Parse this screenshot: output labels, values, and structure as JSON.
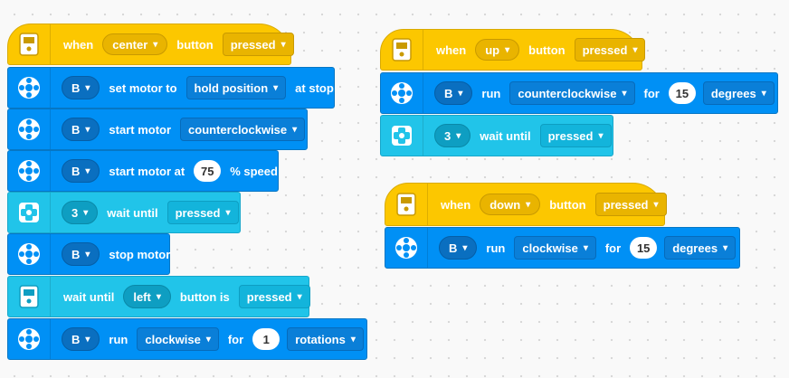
{
  "stack1": {
    "hat": {
      "when": "when",
      "button": "center",
      "mid": "button",
      "state": "pressed"
    },
    "b1": {
      "port": "B",
      "label": "set motor to",
      "mode": "hold position",
      "tail": "at stop"
    },
    "b2": {
      "port": "B",
      "label": "start motor",
      "dir": "counterclockwise"
    },
    "b3": {
      "port": "B",
      "label": "start motor at",
      "value": "75",
      "tail": "% speed"
    },
    "b4": {
      "port": "3",
      "label": "wait until",
      "state": "pressed"
    },
    "b5": {
      "port": "B",
      "label": "stop motor"
    },
    "b6": {
      "label": "wait until",
      "button": "left",
      "mid": "button is",
      "state": "pressed"
    },
    "b7": {
      "port": "B",
      "label": "run",
      "dir": "clockwise",
      "for": "for",
      "value": "1",
      "unit": "rotations"
    }
  },
  "stack2": {
    "hat": {
      "when": "when",
      "button": "up",
      "mid": "button",
      "state": "pressed"
    },
    "b1": {
      "port": "B",
      "label": "run",
      "dir": "counterclockwise",
      "for": "for",
      "value": "15",
      "unit": "degrees"
    },
    "b2": {
      "port": "3",
      "label": "wait until",
      "state": "pressed"
    }
  },
  "stack3": {
    "hat": {
      "when": "when",
      "button": "down",
      "mid": "button",
      "state": "pressed"
    },
    "b1": {
      "port": "B",
      "label": "run",
      "dir": "clockwise",
      "for": "for",
      "value": "15",
      "unit": "degrees"
    }
  },
  "caret": "▾",
  "icons": {
    "hub": "hub-icon",
    "motor": "motor-icon",
    "force": "force-sensor-icon"
  },
  "colors": {
    "motor": "#0090f5",
    "sensor": "#21c4e9",
    "event": "#fcc700"
  }
}
